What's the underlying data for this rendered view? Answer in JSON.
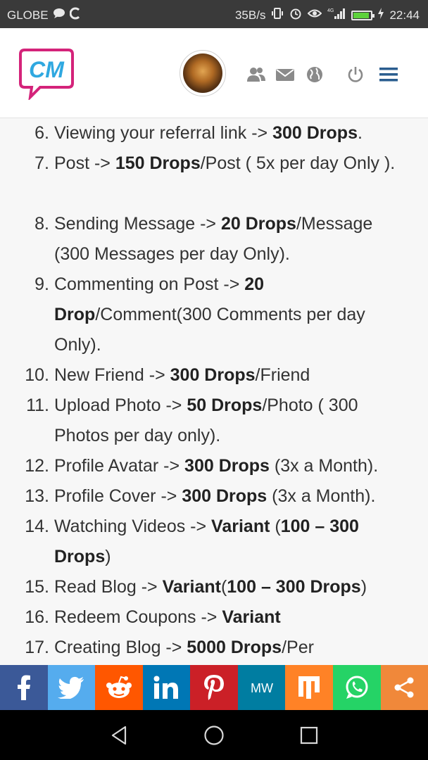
{
  "status_bar": {
    "carrier": "GLOBE",
    "speed": "35B/s",
    "network": "4G",
    "time": "22:44",
    "icons": [
      "chat-icon",
      "sync-icon",
      "vibrate-icon",
      "alarm-icon",
      "eye-icon",
      "signal-icon",
      "battery-icon",
      "charging-icon"
    ]
  },
  "header": {
    "logo_text": "CM",
    "icons": [
      "friends-icon",
      "mail-icon",
      "globe-icon",
      "power-icon",
      "menu-icon"
    ]
  },
  "list": [
    {
      "num": "6.",
      "parts": [
        {
          "t": "Viewing your referral link -> "
        },
        {
          "t": "300 Drops",
          "b": true
        },
        {
          "t": "."
        }
      ]
    },
    {
      "num": "7.",
      "parts": [
        {
          "t": "Post -> "
        },
        {
          "t": "150 Drops",
          "b": true
        },
        {
          "t": "/Post ( 5x per day Only )."
        }
      ]
    },
    {
      "num": "8.",
      "parts": [
        {
          "t": "Sending Message -> "
        },
        {
          "t": "20 Drops",
          "b": true
        },
        {
          "t": "/Message (300 Messages per day Only)."
        }
      ]
    },
    {
      "num": "9.",
      "parts": [
        {
          "t": "Commenting on Post -> "
        },
        {
          "t": "20 Drop",
          "b": true
        },
        {
          "t": "/Comment(300 Comments per day Only)."
        }
      ]
    },
    {
      "num": "10.",
      "parts": [
        {
          "t": "New Friend -> "
        },
        {
          "t": "300 Drops",
          "b": true
        },
        {
          "t": "/Friend"
        }
      ]
    },
    {
      "num": "11.",
      "parts": [
        {
          "t": "Upload Photo -> "
        },
        {
          "t": "50 Drops",
          "b": true
        },
        {
          "t": "/Photo ( 300 Photos per day only)."
        }
      ]
    },
    {
      "num": "12.",
      "parts": [
        {
          "t": "Profile Avatar -> "
        },
        {
          "t": "300 Drops",
          "b": true
        },
        {
          "t": " (3x a Month)."
        }
      ]
    },
    {
      "num": "13.",
      "parts": [
        {
          "t": "Profile Cover -> "
        },
        {
          "t": "300 Drops",
          "b": true
        },
        {
          "t": " (3x a Month)."
        }
      ]
    },
    {
      "num": "14.",
      "parts": [
        {
          "t": "Watching Videos -> "
        },
        {
          "t": "Variant",
          "b": true
        },
        {
          "t": " ("
        },
        {
          "t": "100 – 300 Drops",
          "b": true
        },
        {
          "t": ")"
        }
      ]
    },
    {
      "num": "15.",
      "parts": [
        {
          "t": "Read Blog -> "
        },
        {
          "t": "Variant",
          "b": true
        },
        {
          "t": "("
        },
        {
          "t": "100 – 300 Drops",
          "b": true
        },
        {
          "t": ")"
        }
      ]
    },
    {
      "num": "16.",
      "parts": [
        {
          "t": "Redeem Coupons -> "
        },
        {
          "t": "Variant",
          "b": true
        }
      ]
    },
    {
      "num": "17.",
      "parts": [
        {
          "t": "Creating Blog -> "
        },
        {
          "t": "5000 Drops",
          "b": true
        },
        {
          "t": "/Per"
        }
      ]
    }
  ],
  "share_bar": [
    {
      "name": "facebook",
      "icon": "facebook-icon",
      "color": "#3b5998"
    },
    {
      "name": "twitter",
      "icon": "twitter-icon",
      "color": "#55acee"
    },
    {
      "name": "reddit",
      "icon": "reddit-icon",
      "color": "#ff5700"
    },
    {
      "name": "linkedin",
      "icon": "linkedin-icon",
      "color": "#0077b5"
    },
    {
      "name": "pinterest",
      "icon": "pinterest-icon",
      "color": "#cb2027"
    },
    {
      "name": "mewe",
      "icon": "mewe-icon",
      "color": "#007da1"
    },
    {
      "name": "mix",
      "icon": "mix-icon",
      "color": "#ff8226"
    },
    {
      "name": "whatsapp",
      "icon": "whatsapp-icon",
      "color": "#25d366"
    },
    {
      "name": "share",
      "icon": "share-icon",
      "color": "#f0883a"
    }
  ],
  "nav_bar": [
    "back-icon",
    "home-icon",
    "recents-icon"
  ],
  "colors": {
    "logo_pink": "#d4237a",
    "logo_blue": "#2fa8e0",
    "header_icon": "#8a8a8a",
    "menu_icon": "#2a5d8f"
  }
}
